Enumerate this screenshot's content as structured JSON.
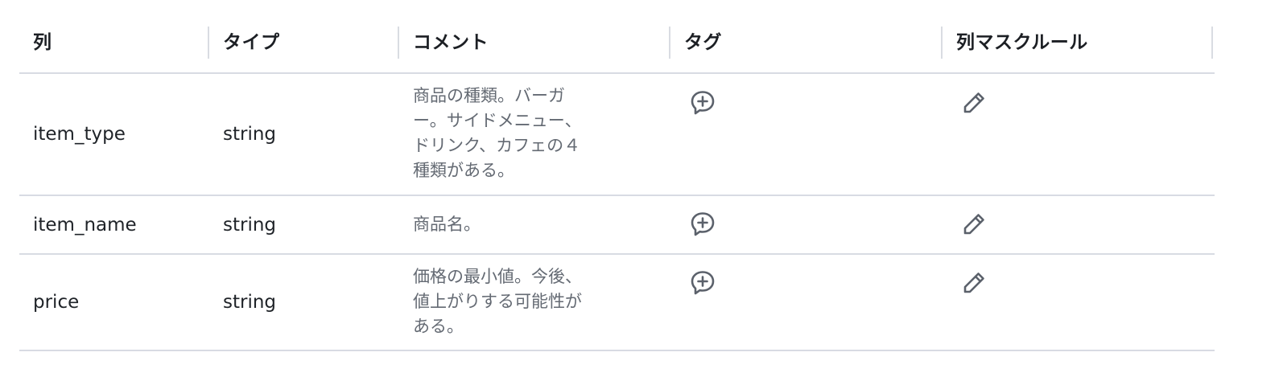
{
  "headers": {
    "column": "列",
    "type": "タイプ",
    "comment": "コメント",
    "tag": "タグ",
    "mask_rule": "列マスクルール"
  },
  "rows": [
    {
      "name": "item_type",
      "type": "string",
      "comment_lines": [
        "商品の種類。バーガ",
        "ー。サイドメニュー、",
        "ドリンク、カフェの４",
        "種類がある。"
      ],
      "tag_icon": "comment-plus-icon",
      "mask_icon": "pencil-icon"
    },
    {
      "name": "item_name",
      "type": "string",
      "comment_lines": [
        "商品名。"
      ],
      "tag_icon": "comment-plus-icon",
      "mask_icon": "pencil-icon"
    },
    {
      "name": "price",
      "type": "string",
      "comment_lines": [
        "価格の最小値。今後、",
        "値上がりする可能性が",
        "ある。"
      ],
      "tag_icon": "comment-plus-icon",
      "mask_icon": "pencil-icon"
    }
  ],
  "colors": {
    "header_text": "#1c1f24",
    "body_text": "#1f2328",
    "comment_text": "#646a73",
    "icon": "#5b616b",
    "divider": "#d8dbe3"
  }
}
